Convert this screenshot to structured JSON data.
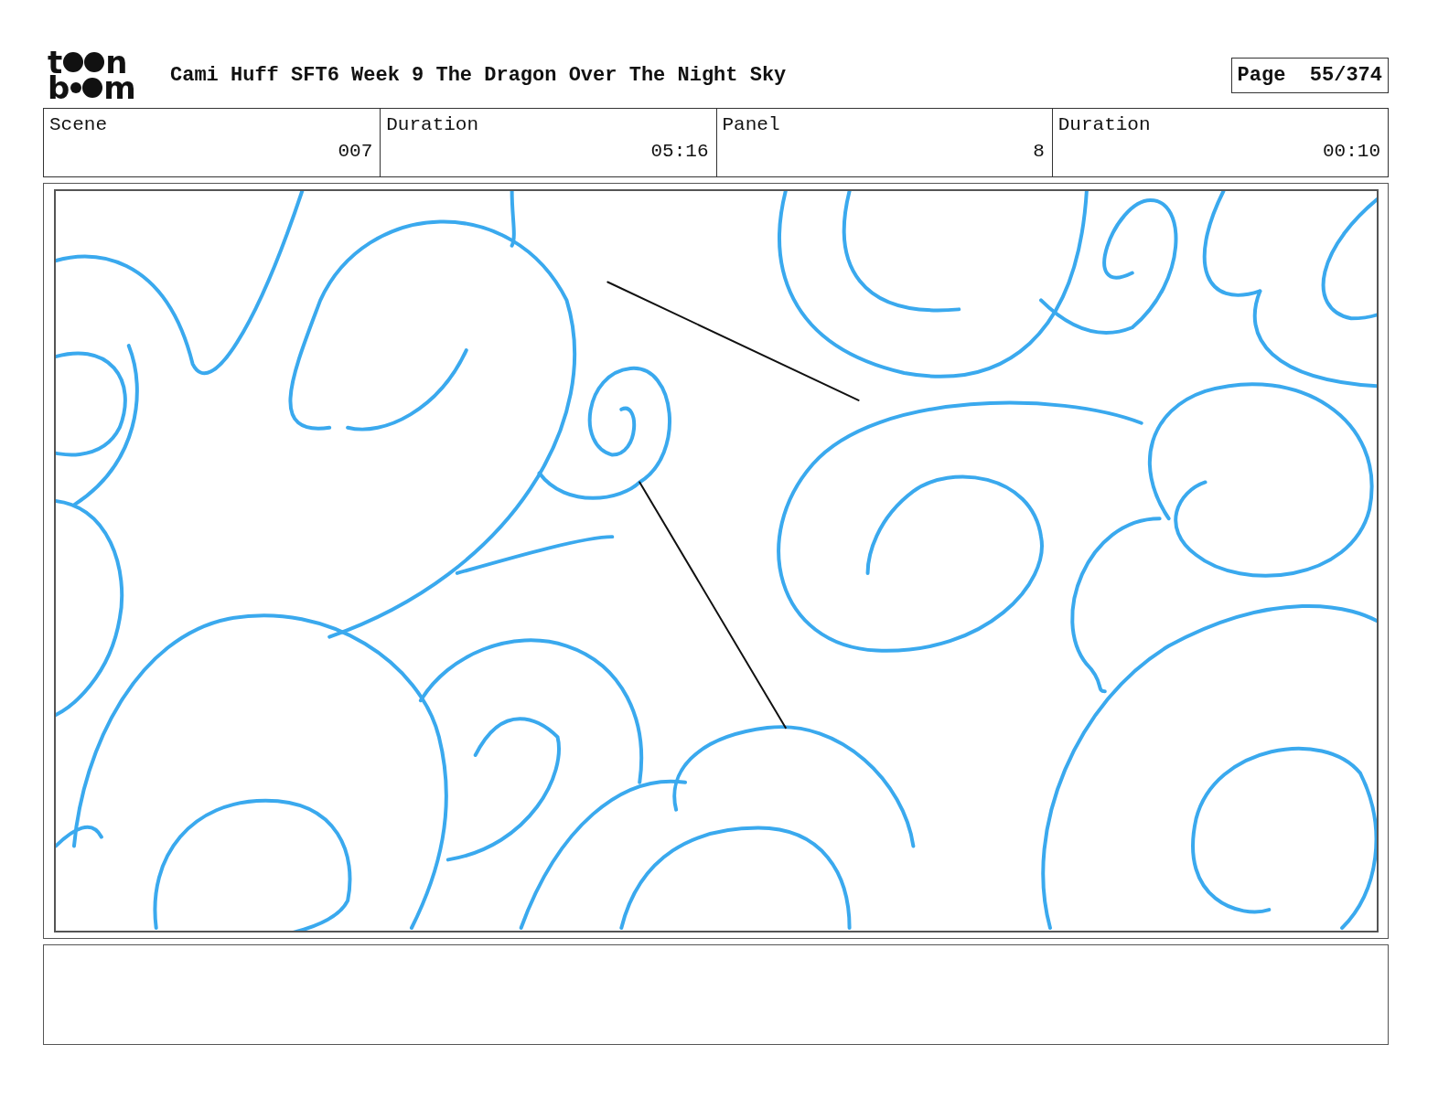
{
  "logo": {
    "top": [
      "t",
      "n"
    ],
    "bottom": [
      "b",
      "m"
    ]
  },
  "title": "Cami Huff SFT6 Week 9 The Dragon Over The Night Sky",
  "page": {
    "label": "Page",
    "value": "55/374"
  },
  "info_table": {
    "column_labels": [
      "Scene",
      "Duration",
      "Panel",
      "Duration"
    ],
    "numbers": [
      "007",
      "05:16",
      "8",
      "00:10"
    ]
  }
}
